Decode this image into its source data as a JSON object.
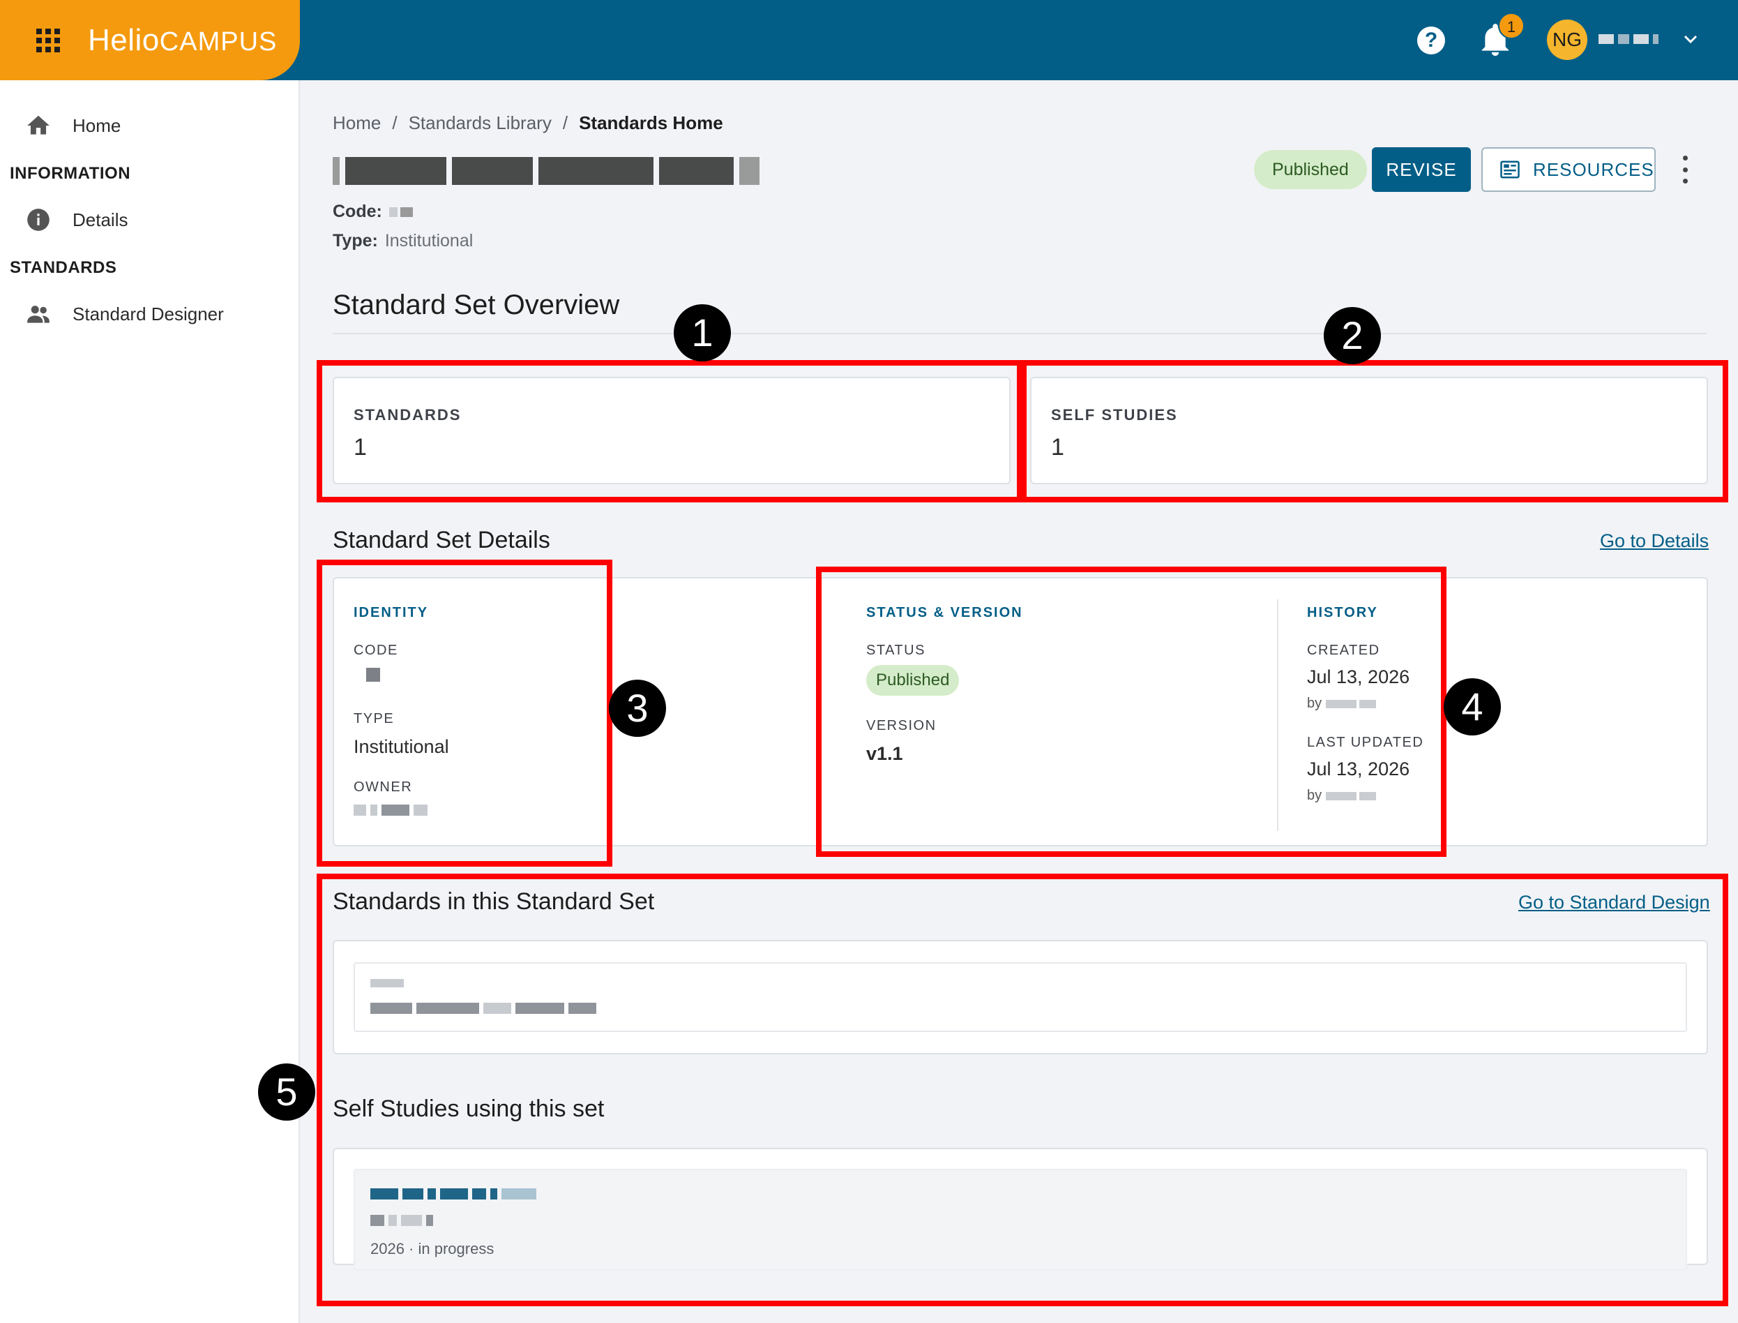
{
  "app": {
    "logo_part1": "Helio",
    "logo_part2": "CAMPUS"
  },
  "header": {
    "notification_count": "1",
    "user_initials": "NG"
  },
  "sidebar": {
    "items": [
      {
        "label": "Home",
        "icon": "home-icon"
      },
      {
        "label": "Details",
        "icon": "info-icon"
      },
      {
        "label": "Standard Designer",
        "icon": "people-icon"
      }
    ],
    "sections": [
      "INFORMATION",
      "STANDARDS"
    ]
  },
  "breadcrumb": [
    "Home",
    "Standards Library",
    "Standards Home"
  ],
  "breadcrumb_sep": "/",
  "page": {
    "code_label": "Code:",
    "type_label": "Type:",
    "type_value": "Institutional",
    "status": "Published",
    "revise_label": "REVISE",
    "resources_label": "RESOURCES"
  },
  "overview": {
    "title": "Standard Set Overview",
    "standards_label": "STANDARDS",
    "standards_count": "1",
    "self_studies_label": "SELF STUDIES",
    "self_studies_count": "1"
  },
  "details": {
    "title": "Standard Set Details",
    "link": "Go to Details",
    "identity_head": "IDENTITY",
    "code_label": "CODE",
    "type_label": "TYPE",
    "type_value": "Institutional",
    "owner_label": "OWNER",
    "status_head": "STATUS & VERSION",
    "status_label": "STATUS",
    "status_value": "Published",
    "version_label": "VERSION",
    "version_value": "v1.1",
    "history_head": "HISTORY",
    "created_label": "CREATED",
    "created_value": "Jul 13, 2026",
    "updated_label": "LAST UPDATED",
    "updated_value": "Jul 13, 2026",
    "by_prefix": "by"
  },
  "standards_section": {
    "title": "Standards in this Standard Set",
    "link": "Go to Standard Design"
  },
  "self_studies_section": {
    "title": "Self Studies using this set",
    "item_meta": "2026 · in progress"
  },
  "annotations": [
    "1",
    "2",
    "3",
    "4",
    "5"
  ],
  "colors": {
    "brand_orange": "#f59a0e",
    "brand_blue": "#035e87",
    "annotation_red": "#ff0000",
    "published_green_bg": "#d4ecc9"
  }
}
